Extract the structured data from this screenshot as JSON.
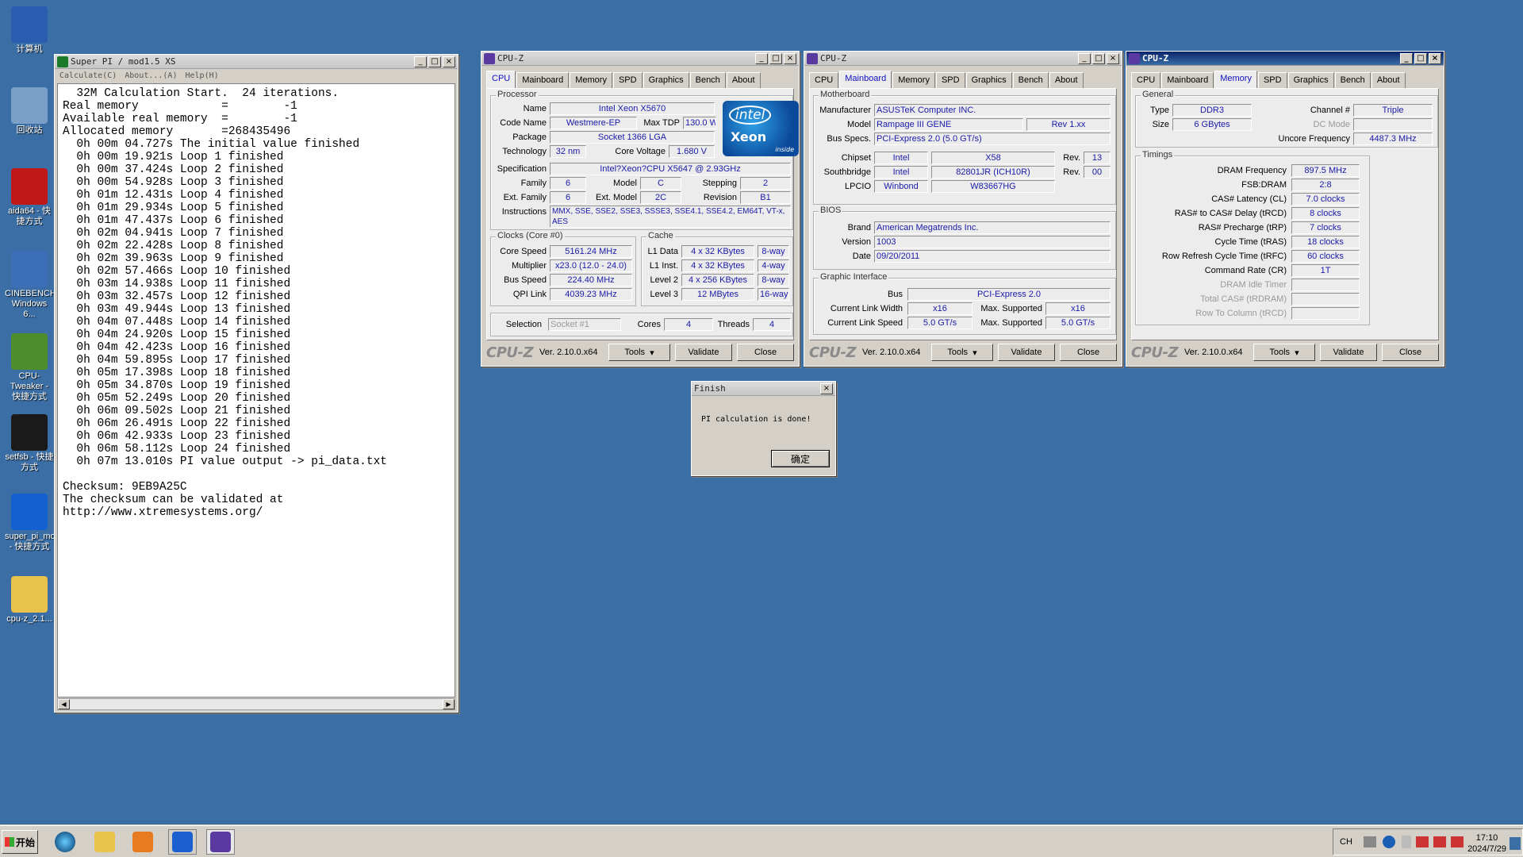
{
  "desktop": {
    "icons": [
      {
        "label": "计算机",
        "name": "computer-icon",
        "color": "#2a5db0"
      },
      {
        "label": "回收站",
        "name": "recycle-bin-icon",
        "color": "#7aa0c8"
      },
      {
        "label": "aida64 - 快捷方式",
        "name": "aida64-icon",
        "color": "#c01818"
      },
      {
        "label": "CINEBENCH Windows 6...",
        "name": "cinebench-icon",
        "color": "#3d6fb8"
      },
      {
        "label": "CPU-Tweaker - 快捷方式",
        "name": "cpu-tweaker-icon",
        "color": "#4e8d2c"
      },
      {
        "label": "setfsb - 快捷方式",
        "name": "setfsb-icon",
        "color": "#1a1a1a"
      },
      {
        "label": "super_pi_mod - 快捷方式",
        "name": "super-pi-icon",
        "color": "#1560d0"
      },
      {
        "label": "cpu-z_2.1...",
        "name": "folder-icon",
        "color": "#e8c24a"
      }
    ]
  },
  "superpi": {
    "title": "Super PI / mod1.5 XS",
    "menu": [
      "Calculate(C)",
      "About...(A)",
      "Help(H)"
    ],
    "lines": [
      "  32M Calculation Start.  24 iterations.",
      "Real memory            =        -1",
      "Available real memory  =        -1",
      "Allocated memory       =268435496",
      "  0h 00m 04.727s The initial value finished",
      "  0h 00m 19.921s Loop 1 finished",
      "  0h 00m 37.424s Loop 2 finished",
      "  0h 00m 54.928s Loop 3 finished",
      "  0h 01m 12.431s Loop 4 finished",
      "  0h 01m 29.934s Loop 5 finished",
      "  0h 01m 47.437s Loop 6 finished",
      "  0h 02m 04.941s Loop 7 finished",
      "  0h 02m 22.428s Loop 8 finished",
      "  0h 02m 39.963s Loop 9 finished",
      "  0h 02m 57.466s Loop 10 finished",
      "  0h 03m 14.938s Loop 11 finished",
      "  0h 03m 32.457s Loop 12 finished",
      "  0h 03m 49.944s Loop 13 finished",
      "  0h 04m 07.448s Loop 14 finished",
      "  0h 04m 24.920s Loop 15 finished",
      "  0h 04m 42.423s Loop 16 finished",
      "  0h 04m 59.895s Loop 17 finished",
      "  0h 05m 17.398s Loop 18 finished",
      "  0h 05m 34.870s Loop 19 finished",
      "  0h 05m 52.249s Loop 20 finished",
      "  0h 06m 09.502s Loop 21 finished",
      "  0h 06m 26.491s Loop 22 finished",
      "  0h 06m 42.933s Loop 23 finished",
      "  0h 06m 58.112s Loop 24 finished",
      "  0h 07m 13.010s PI value output -> pi_data.txt",
      "",
      "Checksum: 9EB9A25C",
      "The checksum can be validated at",
      "http://www.xtremesystems.org/"
    ]
  },
  "cpuz": {
    "title": "CPU-Z",
    "tabs": [
      "CPU",
      "Mainboard",
      "Memory",
      "SPD",
      "Graphics",
      "Bench",
      "About"
    ],
    "brand": "CPU-Z",
    "version": "Ver. 2.10.0.x64",
    "tools_label": "Tools",
    "validate_label": "Validate",
    "close_label": "Close",
    "cpu": {
      "processor_title": "Processor",
      "name_label": "Name",
      "name": "Intel Xeon X5670",
      "codename_label": "Code Name",
      "codename": "Westmere-EP",
      "maxtdp_label": "Max TDP",
      "maxtdp": "130.0 W",
      "package_label": "Package",
      "package": "Socket 1366 LGA",
      "technology_label": "Technology",
      "technology": "32 nm",
      "corevoltage_label": "Core Voltage",
      "corevoltage": "1.680 V",
      "spec_label": "Specification",
      "spec": "Intel?Xeon?CPU          X5647  @ 2.93GHz",
      "family_label": "Family",
      "family": "6",
      "model_label": "Model",
      "model": "C",
      "stepping_label": "Stepping",
      "stepping": "2",
      "extfamily_label": "Ext. Family",
      "extfamily": "6",
      "extmodel_label": "Ext. Model",
      "extmodel": "2C",
      "revision_label": "Revision",
      "revision": "B1",
      "instructions_label": "Instructions",
      "instructions": "MMX, SSE, SSE2, SSE3, SSSE3, SSE4.1, SSE4.2, EM64T, VT-x, AES",
      "logo": {
        "line1": "intel",
        "line2": "Xeon",
        "line3": "inside"
      },
      "clocks_title": "Clocks (Core #0)",
      "corespeed_label": "Core Speed",
      "corespeed": "5161.24 MHz",
      "multiplier_label": "Multiplier",
      "multiplier": "x23.0 (12.0 - 24.0)",
      "busspeed_label": "Bus Speed",
      "busspeed": "224.40 MHz",
      "qpilink_label": "QPI Link",
      "qpilink": "4039.23 MHz",
      "cache_title": "Cache",
      "l1data_label": "L1 Data",
      "l1data": "4 x 32 KBytes",
      "l1data_way": "8-way",
      "l1inst_label": "L1 Inst.",
      "l1inst": "4 x 32 KBytes",
      "l1inst_way": "4-way",
      "l2_label": "Level 2",
      "l2": "4 x 256 KBytes",
      "l2_way": "8-way",
      "l3_label": "Level 3",
      "l3": "12 MBytes",
      "l3_way": "16-way",
      "selection_label": "Selection",
      "selection": "Socket #1",
      "cores_label": "Cores",
      "cores": "4",
      "threads_label": "Threads",
      "threads": "4"
    },
    "mainboard": {
      "mb_title": "Motherboard",
      "manufacturer_label": "Manufacturer",
      "manufacturer": "ASUSTeK Computer INC.",
      "model_label": "Model",
      "model": "Rampage III GENE",
      "rev": "Rev 1.xx",
      "busspecs_label": "Bus Specs.",
      "busspecs": "PCI-Express 2.0 (5.0 GT/s)",
      "chipset_label": "Chipset",
      "chipset_vendor": "Intel",
      "chipset": "X58",
      "chipset_rev_label": "Rev.",
      "chipset_rev": "13",
      "southbridge_label": "Southbridge",
      "sb_vendor": "Intel",
      "southbridge": "82801JR (ICH10R)",
      "sb_rev_label": "Rev.",
      "sb_rev": "00",
      "lpcio_label": "LPCIO",
      "lpcio_vendor": "Winbond",
      "lpcio": "W83667HG",
      "bios_title": "BIOS",
      "brand_label": "Brand",
      "brand": "American Megatrends Inc.",
      "version_label": "Version",
      "version": "1003",
      "date_label": "Date",
      "date": "09/20/2011",
      "gi_title": "Graphic Interface",
      "bus_label": "Bus",
      "bus": "PCI-Express 2.0",
      "linkwidth_label": "Current Link Width",
      "linkwidth": "x16",
      "maxsup1_label": "Max. Supported",
      "maxsup1": "x16",
      "linkspeed_label": "Current Link Speed",
      "linkspeed": "5.0 GT/s",
      "maxsup2_label": "Max. Supported",
      "maxsup2": "5.0 GT/s"
    },
    "memory": {
      "general_title": "General",
      "type_label": "Type",
      "type": "DDR3",
      "channel_label": "Channel #",
      "channel": "Triple",
      "size_label": "Size",
      "size": "6 GBytes",
      "dcmode_label": "DC Mode",
      "uncore_label": "Uncore Frequency",
      "uncore": "4487.3 MHz",
      "timings_title": "Timings",
      "timings": [
        {
          "label": "DRAM Frequency",
          "value": "897.5 MHz",
          "dim": false
        },
        {
          "label": "FSB:DRAM",
          "value": "2:8",
          "dim": false
        },
        {
          "label": "CAS# Latency (CL)",
          "value": "7.0 clocks",
          "dim": false
        },
        {
          "label": "RAS# to CAS# Delay (tRCD)",
          "value": "8 clocks",
          "dim": false
        },
        {
          "label": "RAS# Precharge (tRP)",
          "value": "7 clocks",
          "dim": false
        },
        {
          "label": "Cycle Time (tRAS)",
          "value": "18 clocks",
          "dim": false
        },
        {
          "label": "Row Refresh Cycle Time (tRFC)",
          "value": "60 clocks",
          "dim": false
        },
        {
          "label": "Command Rate (CR)",
          "value": "1T",
          "dim": false
        },
        {
          "label": "DRAM Idle Timer",
          "value": "",
          "dim": true
        },
        {
          "label": "Total CAS# (tRDRAM)",
          "value": "",
          "dim": true
        },
        {
          "label": "Row To Column (tRCD)",
          "value": "",
          "dim": true
        }
      ]
    }
  },
  "finish": {
    "title": "Finish",
    "message": "PI calculation is done!",
    "ok_label": "确定"
  },
  "taskbar": {
    "start_label": "开始",
    "lang": "CH",
    "time": "17:10",
    "date": "2024/7/29"
  }
}
